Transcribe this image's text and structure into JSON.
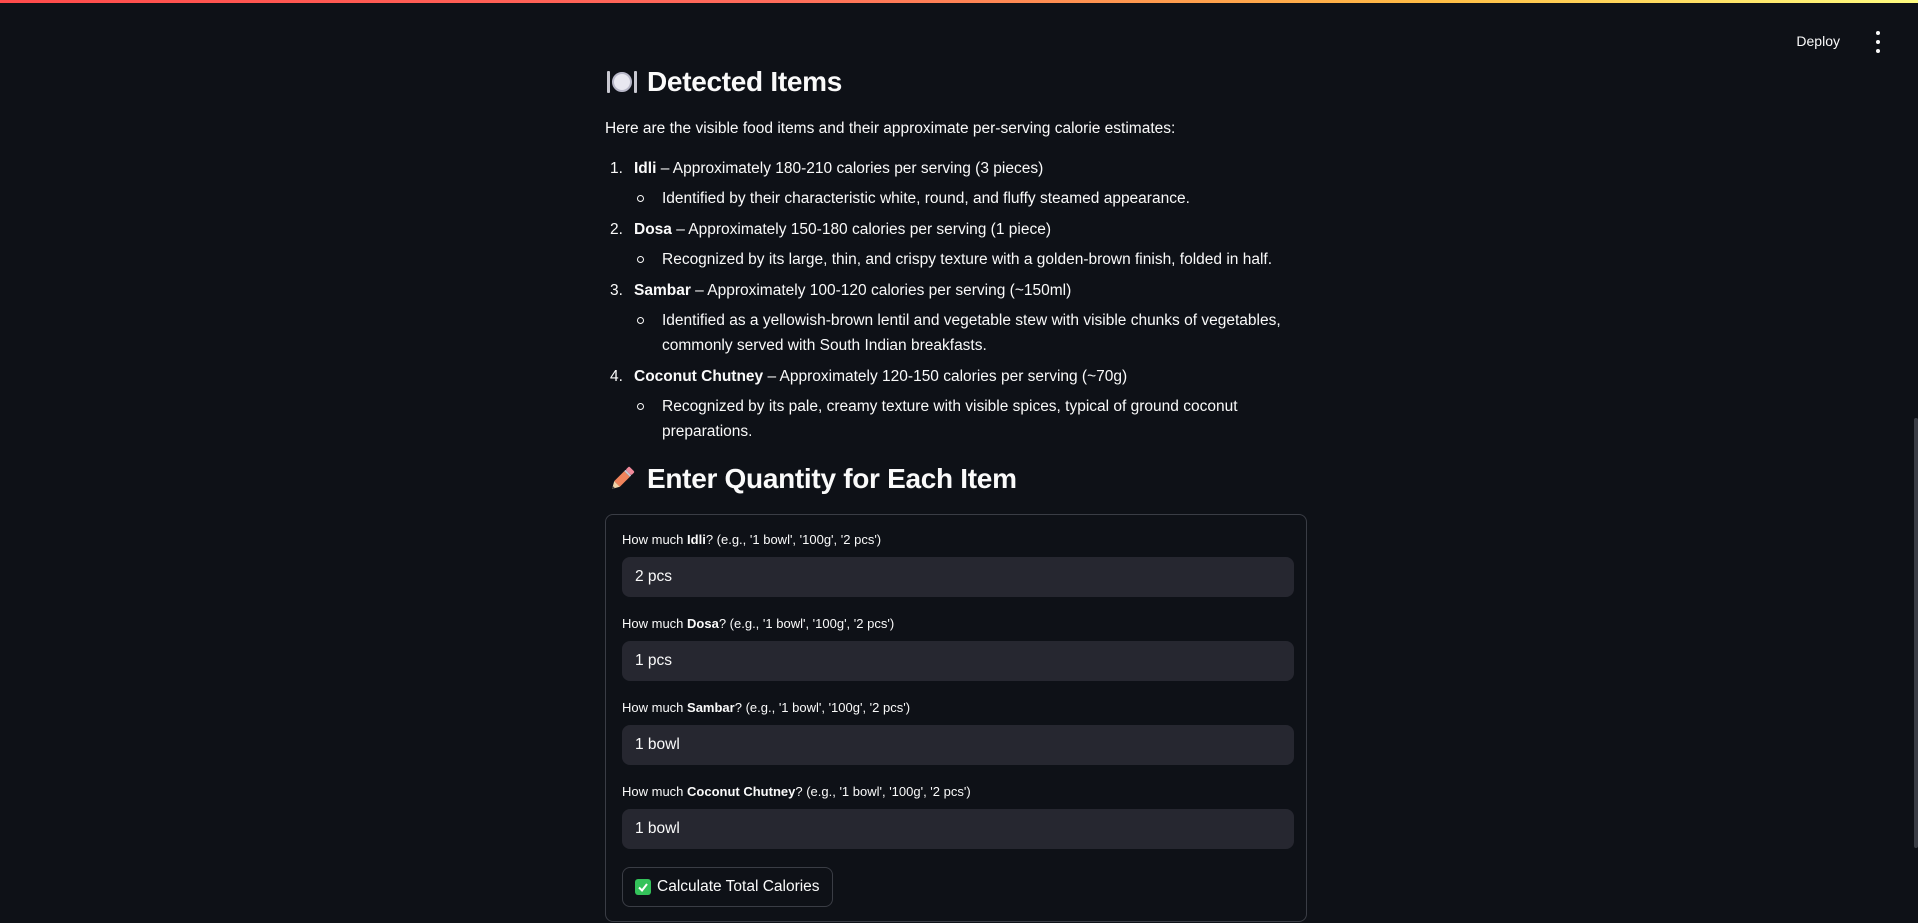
{
  "header": {
    "deploy_label": "Deploy"
  },
  "detected": {
    "title": "Detected Items",
    "intro": "Here are the visible food items and their approximate per-serving calorie estimates:",
    "items": [
      {
        "number": "1.",
        "name": "Idli",
        "estimate": " – Approximately 180-210 calories per serving (3 pieces)",
        "description": "Identified by their characteristic white, round, and fluffy steamed appearance."
      },
      {
        "number": "2.",
        "name": "Dosa",
        "estimate": " – Approximately 150-180 calories per serving (1 piece)",
        "description": "Recognized by its large, thin, and crispy texture with a golden-brown finish, folded in half."
      },
      {
        "number": "3.",
        "name": "Sambar",
        "estimate": " – Approximately 100-120 calories per serving (~150ml)",
        "description": "Identified as a yellowish-brown lentil and vegetable stew with visible chunks of vegetables, commonly served with South Indian breakfasts."
      },
      {
        "number": "4.",
        "name": "Coconut Chutney",
        "estimate": " – Approximately 120-150 calories per serving (~70g)",
        "description": "Recognized by its pale, creamy texture with visible spices, typical of ground coconut preparations."
      }
    ]
  },
  "quantity": {
    "title": "Enter Quantity for Each Item",
    "fields": [
      {
        "prefix": "How much ",
        "item": "Idli",
        "suffix": "? (e.g., '1 bowl', '100g', '2 pcs')",
        "value": "2 pcs"
      },
      {
        "prefix": "How much ",
        "item": "Dosa",
        "suffix": "? (e.g., '1 bowl', '100g', '2 pcs')",
        "value": "1 pcs"
      },
      {
        "prefix": "How much ",
        "item": "Sambar",
        "suffix": "? (e.g., '1 bowl', '100g', '2 pcs')",
        "value": "1 bowl"
      },
      {
        "prefix": "How much ",
        "item": "Coconut Chutney",
        "suffix": "? (e.g., '1 bowl', '100g', '2 pcs')",
        "value": "1 bowl"
      }
    ],
    "calculate_label": "Calculate Total Calories"
  },
  "icons": {
    "detected_title_icon": "plate-with-cutlery-icon",
    "quantity_title_icon": "pencil-icon",
    "calculate_icon": "check-mark-icon",
    "menu_icon": "kebab-menu-icon"
  },
  "colors": {
    "background": "#0e1117",
    "input_background": "#262730",
    "border": "#3a3d45",
    "text": "#fafafa",
    "check_green": "#34c25a",
    "pencil_orange": "#f0845c"
  }
}
